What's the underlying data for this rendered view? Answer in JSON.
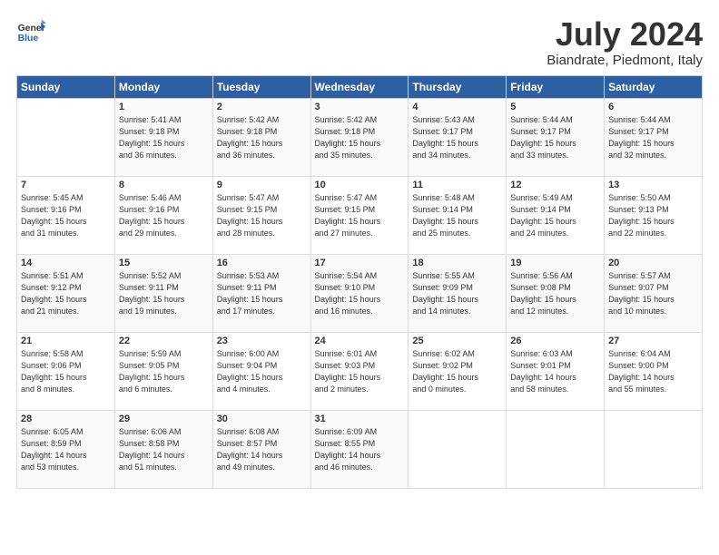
{
  "app": {
    "name": "GeneralBlue",
    "logo_color": "#2e5fa3"
  },
  "title": "July 2024",
  "location": "Biandrate, Piedmont, Italy",
  "days_of_week": [
    "Sunday",
    "Monday",
    "Tuesday",
    "Wednesday",
    "Thursday",
    "Friday",
    "Saturday"
  ],
  "weeks": [
    [
      {
        "num": "",
        "info": ""
      },
      {
        "num": "1",
        "info": "Sunrise: 5:41 AM\nSunset: 9:18 PM\nDaylight: 15 hours\nand 36 minutes."
      },
      {
        "num": "2",
        "info": "Sunrise: 5:42 AM\nSunset: 9:18 PM\nDaylight: 15 hours\nand 36 minutes."
      },
      {
        "num": "3",
        "info": "Sunrise: 5:42 AM\nSunset: 9:18 PM\nDaylight: 15 hours\nand 35 minutes."
      },
      {
        "num": "4",
        "info": "Sunrise: 5:43 AM\nSunset: 9:17 PM\nDaylight: 15 hours\nand 34 minutes."
      },
      {
        "num": "5",
        "info": "Sunrise: 5:44 AM\nSunset: 9:17 PM\nDaylight: 15 hours\nand 33 minutes."
      },
      {
        "num": "6",
        "info": "Sunrise: 5:44 AM\nSunset: 9:17 PM\nDaylight: 15 hours\nand 32 minutes."
      }
    ],
    [
      {
        "num": "7",
        "info": "Sunrise: 5:45 AM\nSunset: 9:16 PM\nDaylight: 15 hours\nand 31 minutes."
      },
      {
        "num": "8",
        "info": "Sunrise: 5:46 AM\nSunset: 9:16 PM\nDaylight: 15 hours\nand 29 minutes."
      },
      {
        "num": "9",
        "info": "Sunrise: 5:47 AM\nSunset: 9:15 PM\nDaylight: 15 hours\nand 28 minutes."
      },
      {
        "num": "10",
        "info": "Sunrise: 5:47 AM\nSunset: 9:15 PM\nDaylight: 15 hours\nand 27 minutes."
      },
      {
        "num": "11",
        "info": "Sunrise: 5:48 AM\nSunset: 9:14 PM\nDaylight: 15 hours\nand 25 minutes."
      },
      {
        "num": "12",
        "info": "Sunrise: 5:49 AM\nSunset: 9:14 PM\nDaylight: 15 hours\nand 24 minutes."
      },
      {
        "num": "13",
        "info": "Sunrise: 5:50 AM\nSunset: 9:13 PM\nDaylight: 15 hours\nand 22 minutes."
      }
    ],
    [
      {
        "num": "14",
        "info": "Sunrise: 5:51 AM\nSunset: 9:12 PM\nDaylight: 15 hours\nand 21 minutes."
      },
      {
        "num": "15",
        "info": "Sunrise: 5:52 AM\nSunset: 9:11 PM\nDaylight: 15 hours\nand 19 minutes."
      },
      {
        "num": "16",
        "info": "Sunrise: 5:53 AM\nSunset: 9:11 PM\nDaylight: 15 hours\nand 17 minutes."
      },
      {
        "num": "17",
        "info": "Sunrise: 5:54 AM\nSunset: 9:10 PM\nDaylight: 15 hours\nand 16 minutes."
      },
      {
        "num": "18",
        "info": "Sunrise: 5:55 AM\nSunset: 9:09 PM\nDaylight: 15 hours\nand 14 minutes."
      },
      {
        "num": "19",
        "info": "Sunrise: 5:56 AM\nSunset: 9:08 PM\nDaylight: 15 hours\nand 12 minutes."
      },
      {
        "num": "20",
        "info": "Sunrise: 5:57 AM\nSunset: 9:07 PM\nDaylight: 15 hours\nand 10 minutes."
      }
    ],
    [
      {
        "num": "21",
        "info": "Sunrise: 5:58 AM\nSunset: 9:06 PM\nDaylight: 15 hours\nand 8 minutes."
      },
      {
        "num": "22",
        "info": "Sunrise: 5:59 AM\nSunset: 9:05 PM\nDaylight: 15 hours\nand 6 minutes."
      },
      {
        "num": "23",
        "info": "Sunrise: 6:00 AM\nSunset: 9:04 PM\nDaylight: 15 hours\nand 4 minutes."
      },
      {
        "num": "24",
        "info": "Sunrise: 6:01 AM\nSunset: 9:03 PM\nDaylight: 15 hours\nand 2 minutes."
      },
      {
        "num": "25",
        "info": "Sunrise: 6:02 AM\nSunset: 9:02 PM\nDaylight: 15 hours\nand 0 minutes."
      },
      {
        "num": "26",
        "info": "Sunrise: 6:03 AM\nSunset: 9:01 PM\nDaylight: 14 hours\nand 58 minutes."
      },
      {
        "num": "27",
        "info": "Sunrise: 6:04 AM\nSunset: 9:00 PM\nDaylight: 14 hours\nand 55 minutes."
      }
    ],
    [
      {
        "num": "28",
        "info": "Sunrise: 6:05 AM\nSunset: 8:59 PM\nDaylight: 14 hours\nand 53 minutes."
      },
      {
        "num": "29",
        "info": "Sunrise: 6:06 AM\nSunset: 8:58 PM\nDaylight: 14 hours\nand 51 minutes."
      },
      {
        "num": "30",
        "info": "Sunrise: 6:08 AM\nSunset: 8:57 PM\nDaylight: 14 hours\nand 49 minutes."
      },
      {
        "num": "31",
        "info": "Sunrise: 6:09 AM\nSunset: 8:55 PM\nDaylight: 14 hours\nand 46 minutes."
      },
      {
        "num": "",
        "info": ""
      },
      {
        "num": "",
        "info": ""
      },
      {
        "num": "",
        "info": ""
      }
    ]
  ]
}
